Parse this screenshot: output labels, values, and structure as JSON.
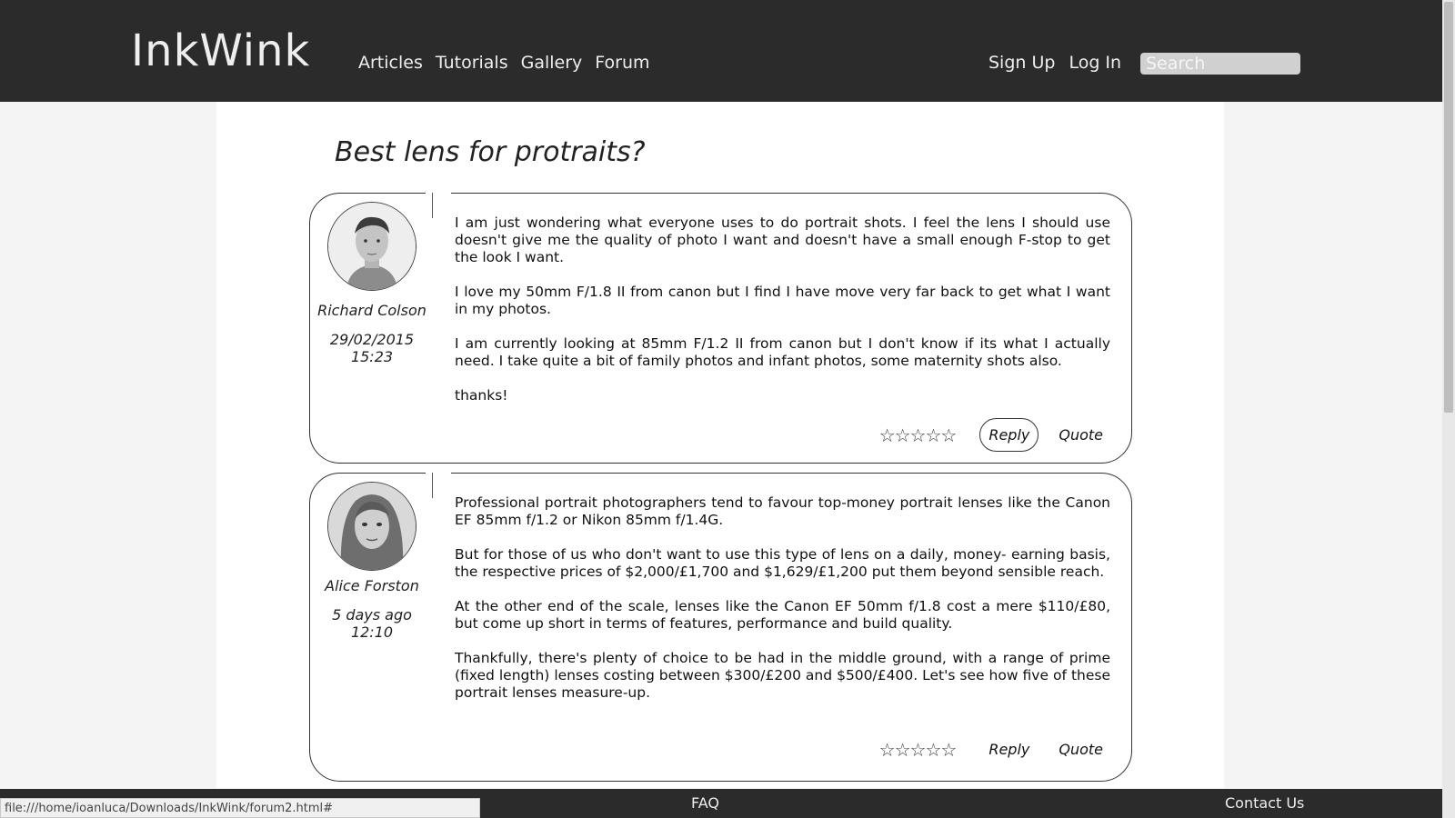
{
  "header": {
    "logo": "InkWink",
    "nav": [
      "Articles",
      "Tutorials",
      "Gallery",
      "Forum"
    ],
    "sign_up": "Sign Up",
    "log_in": "Log In",
    "search_placeholder": "Search"
  },
  "thread": {
    "title": "Best lens for protraits?"
  },
  "posts": [
    {
      "author": "Richard Colson",
      "time": "29/02/2015 15:23",
      "avatar_icon": "male-portrait-avatar",
      "paragraphs": [
        "I am just wondering what everyone uses to do portrait shots. I feel the lens I should use doesn't give me the quality of photo I want and doesn't have a small enough F-stop to get the look I want.",
        "I love my 50mm F/1.8 II from canon but I find I have move very far back to get what I want in my photos.",
        "I am currently looking at 85mm F/1.2 II from canon but I don't know if its what I actually need. I take quite a bit of family photos and infant photos, some maternity shots also.",
        "thanks!"
      ],
      "rating": "☆☆☆☆☆",
      "reply": "Reply",
      "quote": "Quote"
    },
    {
      "author": "Alice Forston",
      "time": "5 days ago 12:10",
      "avatar_icon": "female-portrait-avatar",
      "paragraphs": [
        "Professional portrait photographers tend to favour top-money portrait lenses like the Canon EF 85mm f/1.2 or Nikon 85mm f/1.4G.",
        "But for those of us who don't want to use this type of lens on a daily, money- earning basis, the respective prices of $2,000/£1,700 and $1,629/£1,200 put them beyond sensible reach.",
        "At the other end of the scale, lenses like the Canon EF 50mm f/1.8 cost a mere $110/£80, but come up short in terms of features, performance and build quality.",
        "Thankfully, there's plenty of choice to be had in the middle ground, with a range of prime (fixed length) lenses costing between $300/£200 and $500/£400. Let's see how five of these portrait lenses measure-up."
      ],
      "rating": "☆☆☆☆☆",
      "reply": "Reply",
      "quote": "Quote"
    }
  ],
  "footer": {
    "faq": "FAQ",
    "contact": "Contact Us"
  },
  "status_url": "file:///home/ioanluca/Downloads/InkWink/forum2.html#"
}
